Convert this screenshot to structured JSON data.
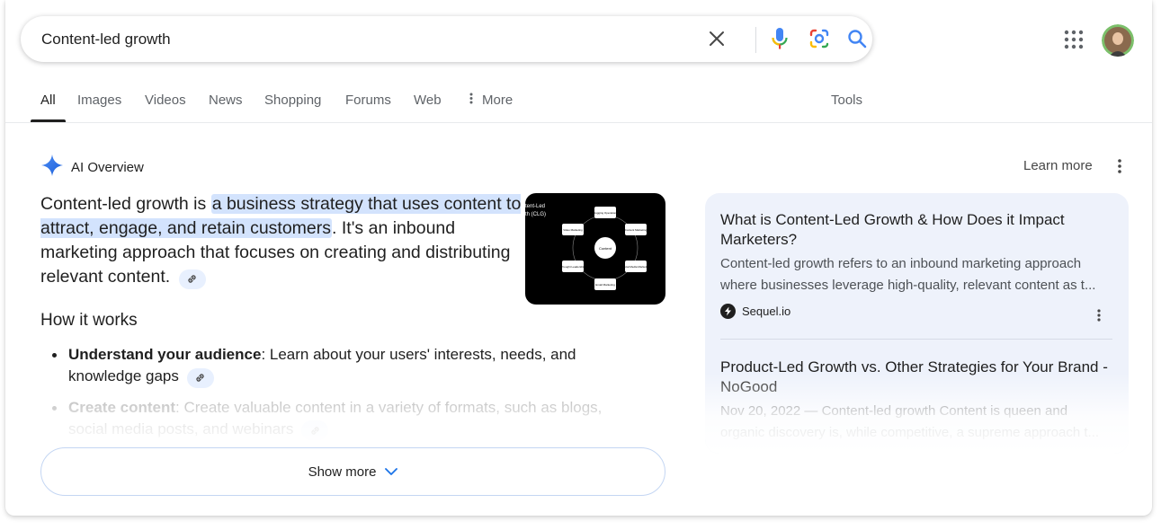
{
  "search": {
    "value": "Content-led growth",
    "icons": [
      "clear-icon",
      "mic-icon",
      "lens-icon",
      "search-icon"
    ]
  },
  "header": {
    "apps_icon": "apps-grid-icon",
    "avatar": "user-avatar"
  },
  "tabs": [
    {
      "label": "All",
      "active": true
    },
    {
      "label": "Images"
    },
    {
      "label": "Videos"
    },
    {
      "label": "News"
    },
    {
      "label": "Shopping"
    },
    {
      "label": "Forums"
    },
    {
      "label": "Web"
    },
    {
      "label": "More"
    }
  ],
  "tools_label": "Tools",
  "ai_overview": {
    "title": "AI Overview",
    "learn_more": "Learn more",
    "intro_prefix": "Content-led growth is ",
    "intro_highlight": "a business strategy that uses content to attract, engage, and retain customers",
    "intro_suffix": ". It's an inbound marketing approach that focuses on creating and distributing relevant content.",
    "thumbnail": {
      "title_lines": [
        "tent-Led",
        "th (CLG)"
      ],
      "center": "Content",
      "nodes": [
        "Blogging Operations",
        "Content Marketing",
        "Social Media Marketing",
        "Email Marketing",
        "Thought Leadership",
        "Video Marketing"
      ]
    },
    "how_title": "How it works",
    "bullets": [
      {
        "bold": "Understand your audience",
        "text": ": Learn about your users' interests, needs, and knowledge gaps"
      },
      {
        "bold": "Create content",
        "text": ": Create valuable content in a variety of formats, such as blogs, social media posts, and webinars"
      }
    ],
    "show_more": "Show more"
  },
  "sources": [
    {
      "title": "What is Content-Led Growth & How Does it Impact Marketers?",
      "snippet_line1": "Content-led growth refers to an inbound marketing approach",
      "snippet_line2": "where businesses leverage high-quality, relevant content as t...",
      "site": "Sequel.io"
    },
    {
      "title": "Product-Led Growth vs. Other Strategies for Your Brand - NoGood",
      "snippet_line1": "Nov 20, 2022 — Content-led growth Content is queen and",
      "snippet_line2": "organic discovery is, while competitive, a supreme approach t..."
    }
  ],
  "colors": {
    "accent_blue": "#1a73e8",
    "highlight": "#d3e3fd",
    "panel_bg": "#eef2fb"
  }
}
